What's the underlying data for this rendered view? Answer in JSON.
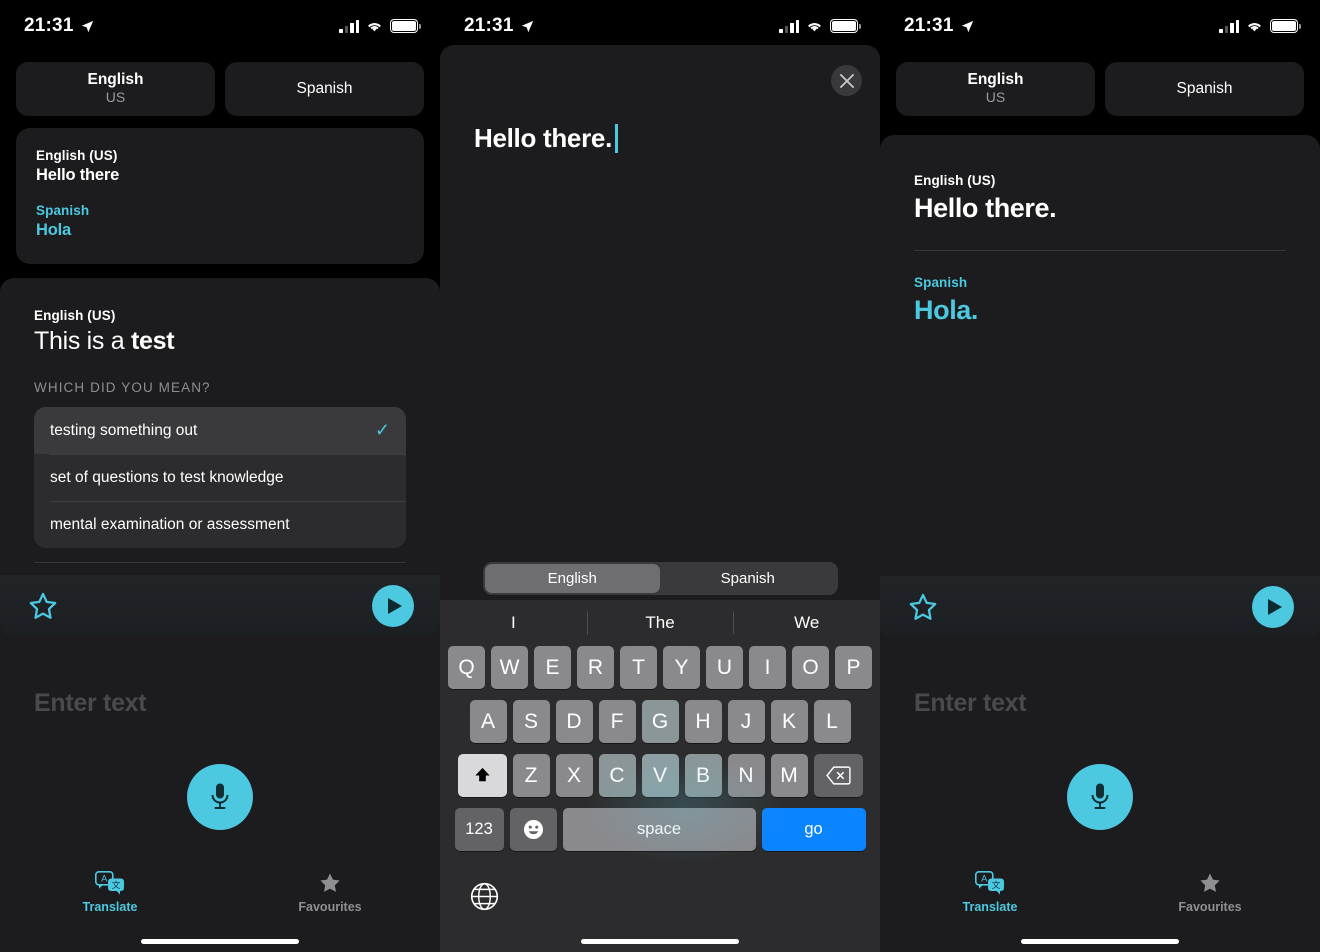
{
  "status_bar": {
    "time": "21:31",
    "location_icon": "location-arrow-icon",
    "signal_icon": "cellular-signal-icon",
    "wifi_icon": "wifi-icon",
    "battery_icon": "battery-full-icon"
  },
  "colors": {
    "accent": "#4cc8e0",
    "card": "#1c1c1e",
    "background": "#000000",
    "key": "#8a8a8e",
    "go_key": "#0a84ff"
  },
  "panel1": {
    "source_lang": {
      "name": "English",
      "region": "US"
    },
    "target_lang": {
      "name": "Spanish",
      "region": ""
    },
    "history_card": {
      "source_label": "English (US)",
      "source_text": "Hello there",
      "target_label": "Spanish",
      "target_text": "Hola"
    },
    "active_card": {
      "source_label": "English (US)",
      "source_text_plain": "This is a ",
      "source_text_bold": "test",
      "disambiguation_title": "WHICH DID YOU MEAN?",
      "options": [
        {
          "label": "testing something out",
          "selected": true,
          "check_icon": "checkmark-icon"
        },
        {
          "label": "set of questions to test knowledge",
          "selected": false
        },
        {
          "label": "mental examination or assessment",
          "selected": false
        }
      ],
      "favorite_icon": "star-outline-icon",
      "play_icon": "play-icon"
    },
    "enter_sheet": {
      "placeholder": "Enter text",
      "mic_icon": "microphone-icon"
    },
    "tabs": [
      {
        "label": "Translate",
        "icon": "translate-icon",
        "active": true
      },
      {
        "label": "Favourites",
        "icon": "star-filled-icon",
        "active": false
      }
    ]
  },
  "panel2": {
    "close_icon": "close-icon",
    "input_text": "Hello there.",
    "language_toggle": [
      {
        "label": "English",
        "selected": true
      },
      {
        "label": "Spanish",
        "selected": false
      }
    ],
    "keyboard": {
      "suggestions": [
        "I",
        "The",
        "We"
      ],
      "row1": [
        "Q",
        "W",
        "E",
        "R",
        "T",
        "Y",
        "U",
        "I",
        "O",
        "P"
      ],
      "row2": [
        "A",
        "S",
        "D",
        "F",
        "G",
        "H",
        "J",
        "K",
        "L"
      ],
      "row3": [
        "Z",
        "X",
        "C",
        "V",
        "B",
        "N",
        "M"
      ],
      "shift_icon": "shift-up-arrow-icon",
      "backspace_icon": "backspace-delete-icon",
      "numbers_key": "123",
      "emoji_icon": "emoji-smiley-icon",
      "space_key": "space",
      "return_key": "go",
      "globe_icon": "globe-language-icon"
    }
  },
  "panel3": {
    "source_lang": {
      "name": "English",
      "region": "US"
    },
    "target_lang": {
      "name": "Spanish",
      "region": ""
    },
    "result_card": {
      "source_label": "English (US)",
      "source_text": "Hello there.",
      "target_label": "Spanish",
      "target_text": "Hola.",
      "favorite_icon": "star-outline-icon",
      "play_icon": "play-icon"
    },
    "enter_sheet": {
      "placeholder": "Enter text",
      "mic_icon": "microphone-icon"
    },
    "tabs": [
      {
        "label": "Translate",
        "icon": "translate-icon",
        "active": true
      },
      {
        "label": "Favourites",
        "icon": "star-filled-icon",
        "active": false
      }
    ]
  }
}
